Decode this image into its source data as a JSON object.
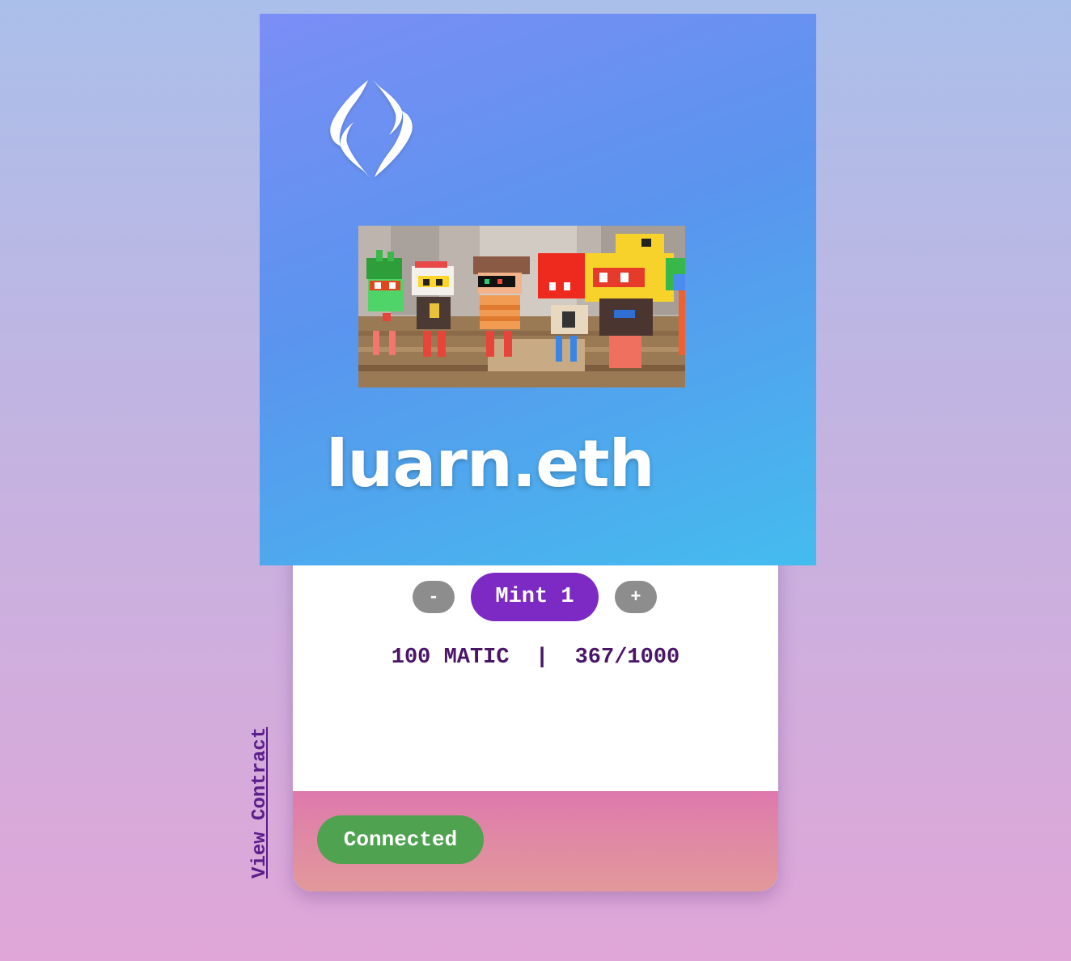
{
  "nft": {
    "ens_name": "luarn.eth"
  },
  "mint": {
    "decrement_label": "-",
    "mint_label": "Mint 1",
    "increment_label": "+"
  },
  "stats": {
    "price": "100 MATIC",
    "separator": "|",
    "supply": "367/1000"
  },
  "wallet": {
    "status_label": "Connected"
  },
  "links": {
    "view_contract": "View Contract"
  },
  "colors": {
    "mint_button": "#7c2ac3",
    "stepper_button": "#8d8d8d",
    "connected_button": "#4fa250",
    "stats_text": "#4a1566",
    "link_text": "#5a1d8a"
  },
  "icons": {
    "logo": "ens-logo-icon"
  }
}
